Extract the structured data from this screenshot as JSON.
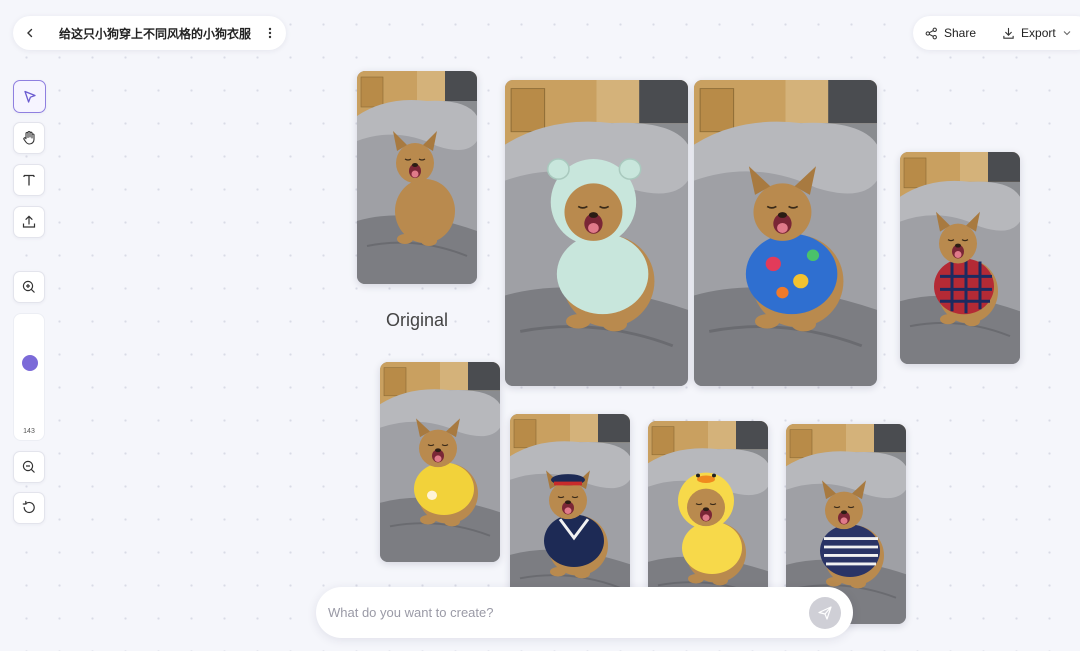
{
  "header": {
    "title": "给这只小狗穿上不同风格的小狗衣服",
    "share_label": "Share",
    "export_label": "Export"
  },
  "toolbar": {
    "tools": [
      "select-tool",
      "hand-tool",
      "text-tool",
      "upload-tool"
    ],
    "zoom_value": "143",
    "zoom_level_fraction": 0.6
  },
  "canvas": {
    "original_label": "Original",
    "images": [
      {
        "name": "original",
        "outfit": "none",
        "color": "#c99652"
      },
      {
        "name": "mint-bear-hoodie",
        "outfit": "mint fleece bear hoodie",
        "color": "#c8e6dc"
      },
      {
        "name": "hawaiian-shirt",
        "outfit": "hawaiian print shirt",
        "color": "#2f6fd0"
      },
      {
        "name": "plaid-shirt",
        "outfit": "red blue plaid shirt",
        "color": "#b42a35"
      },
      {
        "name": "yellow-sweater",
        "outfit": "yellow knit sweater",
        "color": "#f2d23a"
      },
      {
        "name": "sailor-outfit",
        "outfit": "navy sailor outfit with cap",
        "color": "#1d2a55"
      },
      {
        "name": "duck-hoodie",
        "outfit": "yellow duck hoodie",
        "color": "#f7d94a"
      },
      {
        "name": "striped-shirt",
        "outfit": "navy striped shirt",
        "color": "#2a3466"
      }
    ]
  },
  "prompt": {
    "placeholder": "What do you want to create?"
  },
  "colors": {
    "accent": "#7b6ad8",
    "background": "#f5f6fb"
  }
}
